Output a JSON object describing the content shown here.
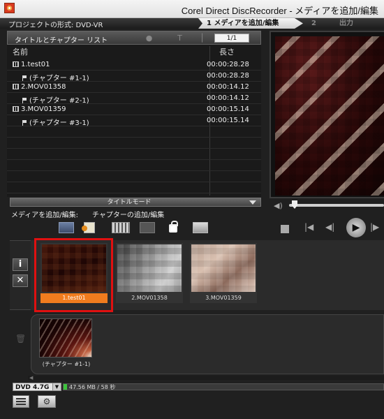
{
  "window": {
    "title": "Corel Direct DiscRecorder - メディアを追加/編集"
  },
  "header": {
    "project_format": "プロジェクトの形式: DVD-VR",
    "steps": [
      {
        "label": "1 メディアを追加/編集"
      },
      {
        "label": "2"
      },
      {
        "label": "出力"
      }
    ]
  },
  "list": {
    "title": "タイトルとチャプター リスト",
    "page": "1/1",
    "col_name": "名前",
    "col_duration": "長さ",
    "rows": [
      {
        "name": "1.test01",
        "duration": "00:00:28.28",
        "kind": "title"
      },
      {
        "name": "(チャプター #1-1)",
        "duration": "00:00:28.28",
        "kind": "chapter"
      },
      {
        "name": "2.MOV01358",
        "duration": "00:00:14.12",
        "kind": "title"
      },
      {
        "name": "(チャプター #2-1)",
        "duration": "00:00:14.12",
        "kind": "chapter"
      },
      {
        "name": "3.MOV01359",
        "duration": "00:00:15.14",
        "kind": "title"
      },
      {
        "name": "(チャプター #3-1)",
        "duration": "00:00:15.14",
        "kind": "chapter"
      }
    ]
  },
  "mode": {
    "label": "タイトルモード",
    "media_label": "メディアを追加/編集:",
    "chapter_label": "チャプターの追加/編集"
  },
  "titles": [
    {
      "caption": "1.test01",
      "selected": true
    },
    {
      "caption": "2.MOV01358",
      "selected": false
    },
    {
      "caption": "3.MOV01359",
      "selected": false
    }
  ],
  "chapters": [
    {
      "caption": "(チャプター #1-1)"
    }
  ],
  "footer": {
    "disc_type": "DVD 4.7G",
    "capacity_text": "47.56 MB / 58 秒",
    "capacity_fraction": 0.01
  },
  "colors": {
    "accent_orange": "#f07c1e",
    "selection_red": "#e01010",
    "capacity_green": "#3cc33c"
  }
}
